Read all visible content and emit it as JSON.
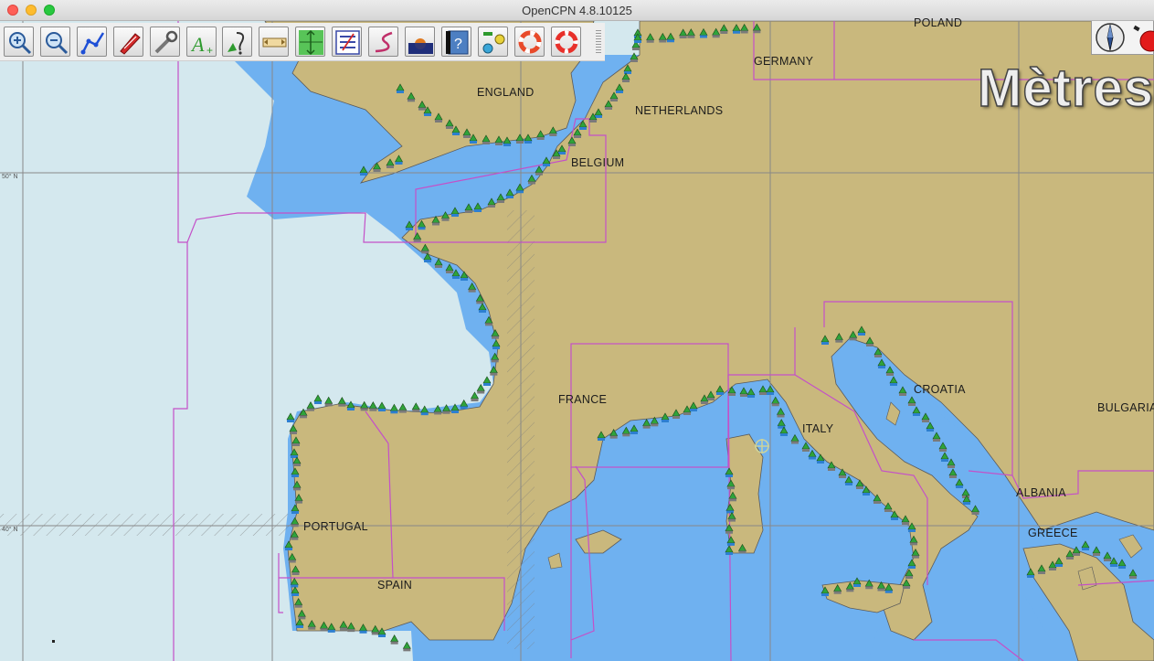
{
  "window": {
    "title": "OpenCPN 4.8.10125"
  },
  "toolbar": {
    "buttons": [
      {
        "name": "zoom-in-button",
        "icon": "zoom-in-icon"
      },
      {
        "name": "zoom-out-button",
        "icon": "zoom-out-icon"
      },
      {
        "name": "route-button",
        "icon": "route-icon"
      },
      {
        "name": "auto-follow-button",
        "icon": "ship-icon"
      },
      {
        "name": "settings-button",
        "icon": "wrench-icon"
      },
      {
        "name": "text-button",
        "icon": "text-add-icon"
      },
      {
        "name": "current-button",
        "icon": "current-icon"
      },
      {
        "name": "measure-button",
        "icon": "ruler-icon"
      },
      {
        "name": "tide-button",
        "icon": "tide-icon"
      },
      {
        "name": "route-manager-button",
        "icon": "list-icon"
      },
      {
        "name": "track-button",
        "icon": "track-icon"
      },
      {
        "name": "color-scheme-button",
        "icon": "dusk-icon"
      },
      {
        "name": "help-button",
        "icon": "help-book-icon"
      },
      {
        "name": "ais-button",
        "icon": "ais-icon"
      },
      {
        "name": "mob-button",
        "icon": "lifering-icon"
      },
      {
        "name": "mob-alt-button",
        "icon": "lifebuoy-icon"
      }
    ]
  },
  "chart": {
    "units_label": "Mètres",
    "lat_labels": [
      "50° N",
      "40° N"
    ],
    "countries": [
      {
        "id": "poland",
        "label": "POLAND"
      },
      {
        "id": "germany",
        "label": "GERMANY"
      },
      {
        "id": "england",
        "label": "ENGLAND"
      },
      {
        "id": "netherlands",
        "label": "NETHERLANDS"
      },
      {
        "id": "belgium",
        "label": "BELGIUM"
      },
      {
        "id": "france",
        "label": "FRANCE"
      },
      {
        "id": "croatia",
        "label": "CROATIA"
      },
      {
        "id": "bulgaria",
        "label": "BULGARIA"
      },
      {
        "id": "italy",
        "label": "ITALY"
      },
      {
        "id": "albania",
        "label": "ALBANIA"
      },
      {
        "id": "portugal",
        "label": "PORTUGAL"
      },
      {
        "id": "greece",
        "label": "GREECE"
      },
      {
        "id": "spain",
        "label": "SPAIN"
      }
    ],
    "colors": {
      "land": "#c9b87d",
      "shallow": "#6fb1f0",
      "deep": "#d4e8ee",
      "chart_border": "#c450c8",
      "grid": "#888888",
      "marker": "#2fa33a"
    }
  }
}
